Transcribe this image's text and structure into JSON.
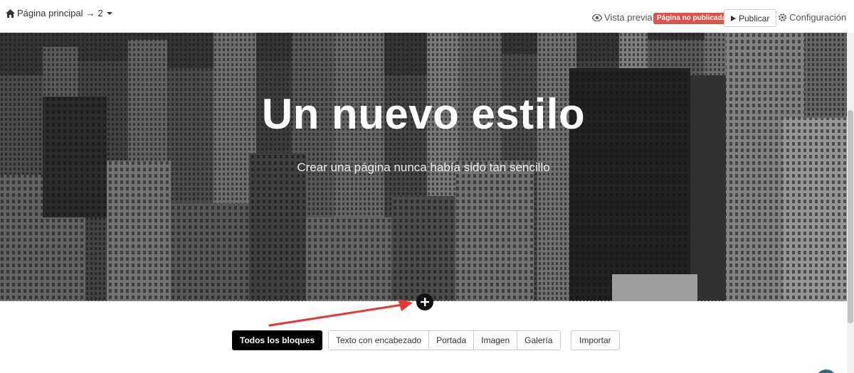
{
  "topbar": {
    "breadcrumb": {
      "home_icon": "home-icon",
      "label": "Página principal",
      "separator": "→",
      "number": "2"
    },
    "preview_label": "Vista previa",
    "unpublished_badge": "Página no publicada",
    "publish_label": "Publicar",
    "settings_label": "Configuración"
  },
  "hero": {
    "title": "Un nuevo estilo",
    "subtitle": "Crear una página nunca había sido tan sencillo"
  },
  "add_block_icon": "plus-icon",
  "annotation": {
    "arrow_color": "#e53935"
  },
  "blocks": {
    "all_label": "Todos los bloques",
    "categories": [
      "Texto con encabezado",
      "Portada",
      "Imagen",
      "Galería"
    ],
    "import_label": "Importar"
  },
  "colors": {
    "badge": "#d9534f",
    "primary_button": "#000000"
  }
}
